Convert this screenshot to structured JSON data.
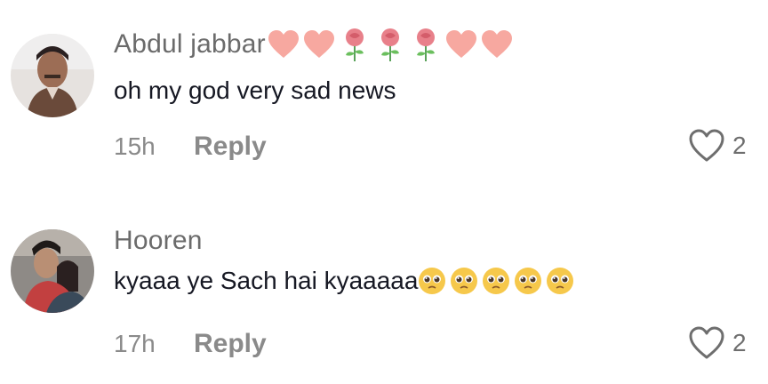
{
  "comments": [
    {
      "username": "Abdul jabbar",
      "username_emojis": [
        "heart-peach",
        "heart-peach",
        "rose",
        "rose",
        "rose",
        "heart-peach",
        "heart-peach"
      ],
      "text": "oh my god very sad news",
      "text_emojis": [],
      "time": "15h",
      "reply_label": "Reply",
      "like_count": "2"
    },
    {
      "username": "Hooren",
      "username_emojis": [],
      "text": "kyaaa ye Sach hai kyaaaaa",
      "text_emojis": [
        "pleading-face",
        "pleading-face",
        "pleading-face",
        "pleading-face",
        "pleading-face"
      ],
      "time": "17h",
      "reply_label": "Reply",
      "like_count": "2"
    }
  ],
  "colors": {
    "heart": "#f7a8a0",
    "rose": "#e8808a",
    "emoji_face": "#f6c84b",
    "muted_text": "#8a8a8a",
    "main_text": "#161823"
  }
}
